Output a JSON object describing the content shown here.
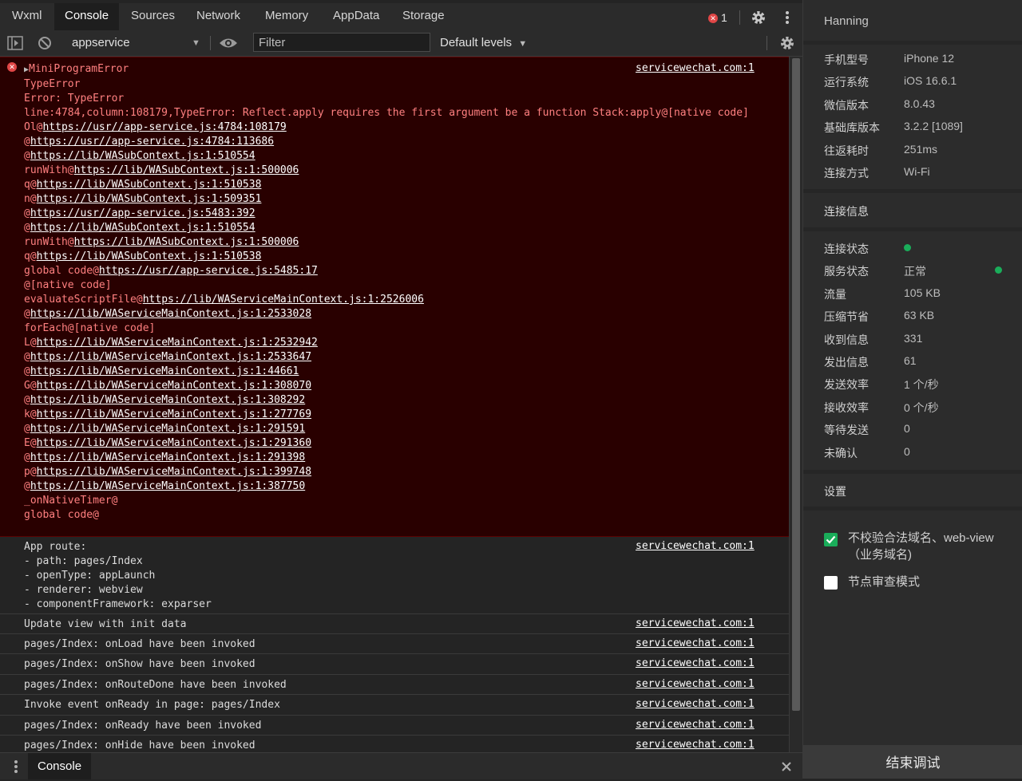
{
  "tabs": [
    "Wxml",
    "Console",
    "Sources",
    "Network",
    "Memory",
    "AppData",
    "Storage"
  ],
  "error_count": "1",
  "toolbar": {
    "context": "appservice",
    "filter_placeholder": "Filter",
    "levels": "Default levels"
  },
  "error_message": {
    "source": "servicewechat.com:1",
    "lines": [
      "MiniProgramError",
      "TypeError",
      "Error: TypeError",
      "line:4784,column:108179,TypeError: Reflect.apply requires the first argument be a function Stack:apply@[native code]"
    ],
    "stack": [
      {
        "pre": "Ol@",
        "link": "https://usr//app-service.js:4784:108179"
      },
      {
        "pre": "@",
        "link": "https://usr//app-service.js:4784:113686"
      },
      {
        "pre": "@",
        "link": "https://lib/WASubContext.js:1:510554"
      },
      {
        "pre": "runWith@",
        "link": "https://lib/WASubContext.js:1:500006"
      },
      {
        "pre": "q@",
        "link": "https://lib/WASubContext.js:1:510538"
      },
      {
        "pre": "n@",
        "link": "https://lib/WASubContext.js:1:509351"
      },
      {
        "pre": "@",
        "link": "https://usr//app-service.js:5483:392"
      },
      {
        "pre": "@",
        "link": "https://lib/WASubContext.js:1:510554"
      },
      {
        "pre": "runWith@",
        "link": "https://lib/WASubContext.js:1:500006"
      },
      {
        "pre": "q@",
        "link": "https://lib/WASubContext.js:1:510538"
      },
      {
        "pre": "global code@",
        "link": "https://usr//app-service.js:5485:17"
      },
      {
        "pre": "@[native code]",
        "link": ""
      },
      {
        "pre": "evaluateScriptFile@",
        "link": "https://lib/WAServiceMainContext.js:1:2526006"
      },
      {
        "pre": "@",
        "link": "https://lib/WAServiceMainContext.js:1:2533028"
      },
      {
        "pre": "forEach@[native code]",
        "link": ""
      },
      {
        "pre": "L@",
        "link": "https://lib/WAServiceMainContext.js:1:2532942"
      },
      {
        "pre": "@",
        "link": "https://lib/WAServiceMainContext.js:1:2533647"
      },
      {
        "pre": "@",
        "link": "https://lib/WAServiceMainContext.js:1:44661"
      },
      {
        "pre": "G@",
        "link": "https://lib/WAServiceMainContext.js:1:308070"
      },
      {
        "pre": "@",
        "link": "https://lib/WAServiceMainContext.js:1:308292"
      },
      {
        "pre": "k@",
        "link": "https://lib/WAServiceMainContext.js:1:277769"
      },
      {
        "pre": "@",
        "link": "https://lib/WAServiceMainContext.js:1:291591"
      },
      {
        "pre": "E@",
        "link": "https://lib/WAServiceMainContext.js:1:291360"
      },
      {
        "pre": "@",
        "link": "https://lib/WAServiceMainContext.js:1:291398"
      },
      {
        "pre": "p@",
        "link": "https://lib/WAServiceMainContext.js:1:399748"
      },
      {
        "pre": "@",
        "link": "https://lib/WAServiceMainContext.js:1:387750"
      },
      {
        "pre": "_onNativeTimer@",
        "link": ""
      },
      {
        "pre": "global code@",
        "link": ""
      }
    ]
  },
  "log_messages": [
    {
      "text": "App route:\n- path: pages/Index\n- openType: appLaunch\n- renderer: webview\n- componentFramework: exparser",
      "source": "servicewechat.com:1"
    },
    {
      "text": "Update view with init data",
      "source": "servicewechat.com:1"
    },
    {
      "text": "pages/Index: onLoad have been invoked",
      "source": "servicewechat.com:1"
    },
    {
      "text": "pages/Index: onShow have been invoked",
      "source": "servicewechat.com:1"
    },
    {
      "text": "pages/Index: onRouteDone have been invoked",
      "source": "servicewechat.com:1"
    },
    {
      "text": "Invoke event onReady in page: pages/Index",
      "source": "servicewechat.com:1"
    },
    {
      "text": "pages/Index: onReady have been invoked",
      "source": "servicewechat.com:1"
    },
    {
      "text": "pages/Index: onHide have been invoked",
      "source": "servicewechat.com:1"
    }
  ],
  "drawer": {
    "tab": "Console"
  },
  "panel": {
    "user": "Hanning",
    "device": [
      {
        "k": "手机型号",
        "v": "iPhone 12"
      },
      {
        "k": "运行系统",
        "v": "iOS 16.6.1"
      },
      {
        "k": "微信版本",
        "v": "8.0.43"
      },
      {
        "k": "基础库版本",
        "v": "3.2.2 [1089]"
      },
      {
        "k": "往返耗时",
        "v": "251ms"
      },
      {
        "k": "连接方式",
        "v": "Wi-Fi"
      }
    ],
    "conn_title": "连接信息",
    "conn": [
      {
        "k": "连接状态",
        "v": ""
      },
      {
        "k": "服务状态",
        "v": "正常"
      },
      {
        "k": "流量",
        "v": "105 KB"
      },
      {
        "k": "压缩节省",
        "v": "63 KB"
      },
      {
        "k": "收到信息",
        "v": "331"
      },
      {
        "k": "发出信息",
        "v": "61"
      },
      {
        "k": "发送效率",
        "v": "1 个/秒"
      },
      {
        "k": "接收效率",
        "v": "0 个/秒"
      },
      {
        "k": "等待发送",
        "v": "0"
      },
      {
        "k": "未确认",
        "v": "0"
      }
    ],
    "settings_title": "设置",
    "settings": [
      {
        "label": "不校验合法域名、web-view（业务域名)",
        "checked": true
      },
      {
        "label": "节点审查模式",
        "checked": false
      }
    ],
    "end_button": "结束调试"
  },
  "colors": {
    "error_bg": "#290000",
    "error_text": "#ff8080",
    "status_green": "#1aad5a"
  }
}
